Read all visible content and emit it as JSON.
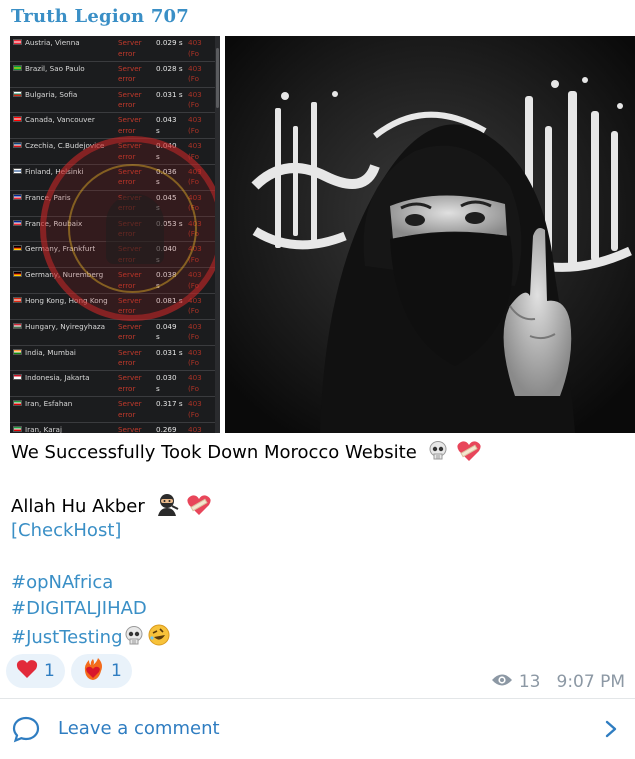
{
  "channel": {
    "name": "Truth Legion 707"
  },
  "screenshot": {
    "rows": [
      {
        "location": "Austria, Vienna",
        "status": [
          "Server",
          "error"
        ],
        "time": [
          "0.029 s",
          ""
        ],
        "code": [
          "403",
          "(Fo"
        ],
        "flag": [
          "#ed2939",
          "#ffffff",
          "#ed2939"
        ]
      },
      {
        "location": "Brazil, Sao Paulo",
        "status": [
          "Server",
          "error"
        ],
        "time": [
          "0.028 s",
          ""
        ],
        "code": [
          "403",
          "(Fo"
        ],
        "flag": [
          "#009c3b",
          "#ffdf00",
          "#009c3b"
        ]
      },
      {
        "location": "Bulgaria, Sofia",
        "status": [
          "Server",
          "error"
        ],
        "time": [
          "0.031 s",
          ""
        ],
        "code": [
          "403",
          "(Fo"
        ],
        "flag": [
          "#ffffff",
          "#00966e",
          "#d62612"
        ]
      },
      {
        "location": "Canada, Vancouver",
        "status": [
          "Server",
          "error"
        ],
        "time": [
          "0.043",
          "s"
        ],
        "code": [
          "403",
          "(Fo"
        ],
        "flag": [
          "#ff0000",
          "#ffffff",
          "#ff0000"
        ]
      },
      {
        "location": "Czechia, C.Budejovice",
        "status": [
          "Server",
          "error"
        ],
        "time": [
          "0.040",
          "s"
        ],
        "code": [
          "403",
          "(Fo"
        ],
        "flag": [
          "#11457e",
          "#ffffff",
          "#d7141a"
        ]
      },
      {
        "location": "Finland, Helsinki",
        "status": [
          "Server",
          "error"
        ],
        "time": [
          "0.036",
          "s"
        ],
        "code": [
          "403",
          "(Fo"
        ],
        "flag": [
          "#ffffff",
          "#003580",
          "#ffffff"
        ]
      },
      {
        "location": "France, Paris",
        "status": [
          "Server",
          "error"
        ],
        "time": [
          "0.045",
          "s"
        ],
        "code": [
          "403",
          "(Fo"
        ],
        "flag": [
          "#002395",
          "#ffffff",
          "#ed2939"
        ]
      },
      {
        "location": "France, Roubaix",
        "status": [
          "Server",
          "error"
        ],
        "time": [
          "0.053 s",
          ""
        ],
        "code": [
          "403",
          "(Fo"
        ],
        "flag": [
          "#002395",
          "#ffffff",
          "#ed2939"
        ]
      },
      {
        "location": "Germany, Frankfurt",
        "status": [
          "Server",
          "error"
        ],
        "time": [
          "0.040",
          "s"
        ],
        "code": [
          "403",
          "(Fo"
        ],
        "flag": [
          "#000000",
          "#dd0000",
          "#ffce00"
        ]
      },
      {
        "location": "Germany, Nuremberg",
        "status": [
          "Server",
          "error"
        ],
        "time": [
          "0.038",
          "s"
        ],
        "code": [
          "403",
          "(Fo"
        ],
        "flag": [
          "#000000",
          "#dd0000",
          "#ffce00"
        ]
      },
      {
        "location": "Hong Kong, Hong Kong",
        "status": [
          "Server",
          "error"
        ],
        "time": [
          "0.081 s",
          ""
        ],
        "code": [
          "403",
          "(Fo"
        ],
        "flag": [
          "#de2910",
          "#ffffff",
          "#de2910"
        ]
      },
      {
        "location": "Hungary, Nyiregyhaza",
        "status": [
          "Server",
          "error"
        ],
        "time": [
          "0.049",
          "s"
        ],
        "code": [
          "403",
          "(Fo"
        ],
        "flag": [
          "#ce2939",
          "#ffffff",
          "#477050"
        ]
      },
      {
        "location": "India, Mumbai",
        "status": [
          "Server",
          "error"
        ],
        "time": [
          "0.031 s",
          ""
        ],
        "code": [
          "403",
          "(Fo"
        ],
        "flag": [
          "#ff9933",
          "#ffffff",
          "#138808"
        ]
      },
      {
        "location": "Indonesia, Jakarta",
        "status": [
          "Server",
          "error"
        ],
        "time": [
          "0.030",
          "s"
        ],
        "code": [
          "403",
          "(Fo"
        ],
        "flag": [
          "#ce1126",
          "#ffffff",
          "#ffffff"
        ]
      },
      {
        "location": "Iran, Esfahan",
        "status": [
          "Server",
          "error"
        ],
        "time": [
          "0.317 s",
          ""
        ],
        "code": [
          "403",
          "(Fo"
        ],
        "flag": [
          "#239f40",
          "#ffffff",
          "#da0000"
        ]
      },
      {
        "location": "Iran, Karaj",
        "status": [
          "Server",
          ""
        ],
        "time": [
          "0.269",
          ""
        ],
        "code": [
          "403",
          ""
        ],
        "flag": [
          "#239f40",
          "#ffffff",
          "#da0000"
        ]
      }
    ]
  },
  "post": {
    "line1": "We Successfully Took Down Morocco Website",
    "line2": "Allah Hu Akber",
    "link": "[CheckHost]",
    "hashtag1": "#opNAfrica",
    "hashtag2": "#DIGITALJIHAD",
    "hashtag3": "#JustTesting"
  },
  "reactions": [
    {
      "icon": "heart-icon",
      "count": "1"
    },
    {
      "icon": "heart-on-fire-icon",
      "count": "1"
    }
  ],
  "meta": {
    "views": "13",
    "time": "9:07 PM"
  },
  "comment": {
    "label": "Leave a comment"
  },
  "colors": {
    "accent": "#3a8fc6",
    "link": "#2f7dc1",
    "muted": "#8c98a4",
    "reaction_bg": "#e9f2fa"
  }
}
